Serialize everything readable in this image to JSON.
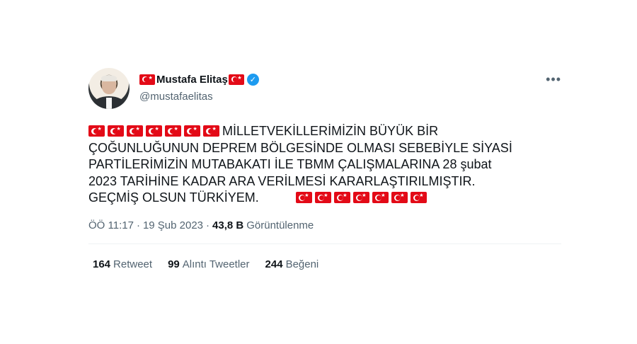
{
  "author": {
    "display_name": "Mustafa Elitaş",
    "handle": "@mustafaelitas",
    "verified": true,
    "name_icons": [
      "flag-turkey-icon",
      "flag-turkey-icon"
    ],
    "verified_icon": "verified-badge-icon"
  },
  "more_label": "•••",
  "tweet": {
    "text_line1": "MİLLETVEKİLLERİMİZİN BÜYÜK BİR",
    "text_line2": "ÇOĞUNLUĞUNUN DEPREM BÖLGESİNDE OLMASI SEBEBİYLE SİYASİ",
    "text_line3": "PARTİLERİMİZİN MUTABAKATI İLE TBMM ÇALIŞMALARINA 28 şubat",
    "text_line4": "2023 TARİHİNE KADAR ARA VERİLMESİ KARARLAŞTIRILMIŞTIR.",
    "text_line5": "GEÇMİŞ OLSUN TÜRKİYEM.",
    "leading_flag_count": 7,
    "trailing_flag_count": 7
  },
  "meta": {
    "time": "ÖÖ 11:17",
    "separator": "·",
    "date": "19 Şub 2023",
    "views_count": "43,8 B",
    "views_label": "Görüntülenme"
  },
  "stats": {
    "retweets_count": "164",
    "retweets_label": "Retweet",
    "quotes_count": "99",
    "quotes_label": "Alıntı Tweetler",
    "likes_count": "244",
    "likes_label": "Beğeni"
  },
  "colors": {
    "flag_red": "#e30a17",
    "verified_blue": "#1d9bf0",
    "secondary_text": "#536471",
    "primary_text": "#0f1419"
  }
}
